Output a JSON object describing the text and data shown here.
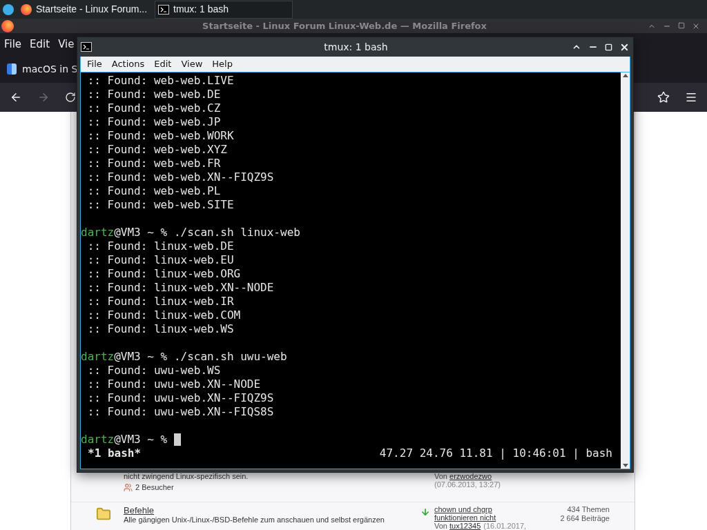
{
  "taskbar": {
    "tasks": [
      {
        "label": "Startseite - Linux Forum...",
        "kind": "browser",
        "selected": false
      },
      {
        "label": "tmux: 1 bash",
        "kind": "terminal",
        "selected": true
      }
    ]
  },
  "browser": {
    "title": "Startseite - Linux Forum Linux-Web.de — Mozilla Firefox",
    "menu": [
      "File",
      "Edit",
      "Vie"
    ],
    "tab": {
      "label": "macOS in S"
    },
    "forward_disabled": true,
    "forum_rows": [
      {
        "title": null,
        "description": "nicht zwingend Linux-spezifisch sein.",
        "visitors": "2 Besucher",
        "last_post": null,
        "author_prefix": "Von ",
        "author": "erzwodezwo",
        "date": "(07.06.2013, 13:27)",
        "stats": []
      },
      {
        "title": "Befehle",
        "description": "Alle gängigen Unix-/Linux-/BSD-Befehle zum anschauen und selbst ergänzen",
        "visitors": null,
        "last_post": [
          "chown und chgrp",
          "funktionieren nicht"
        ],
        "author_prefix": "Von ",
        "author": "tux12345",
        "date": "(16.01.2017,",
        "date_inline": true,
        "stats": [
          "434 Themen",
          "2 664 Beiträge"
        ]
      }
    ]
  },
  "terminal": {
    "title": "tmux: 1 bash",
    "menu": [
      "File",
      "Actions",
      "Edit",
      "View",
      "Help"
    ],
    "lines": [
      {
        "kind": "output",
        "text": " :: Found: web-web.LIVE"
      },
      {
        "kind": "output",
        "text": " :: Found: web-web.DE"
      },
      {
        "kind": "output",
        "text": " :: Found: web-web.CZ"
      },
      {
        "kind": "output",
        "text": " :: Found: web-web.JP"
      },
      {
        "kind": "output",
        "text": " :: Found: web-web.WORK"
      },
      {
        "kind": "output",
        "text": " :: Found: web-web.XYZ"
      },
      {
        "kind": "output",
        "text": " :: Found: web-web.FR"
      },
      {
        "kind": "output",
        "text": " :: Found: web-web.XN--FIQZ9S"
      },
      {
        "kind": "output",
        "text": " :: Found: web-web.PL"
      },
      {
        "kind": "output",
        "text": " :: Found: web-web.SITE"
      },
      {
        "kind": "blank"
      },
      {
        "kind": "prompt",
        "user": "dartz",
        "host": "@VM3 ~ % ",
        "command": "./scan.sh linux-web",
        "cursor": false
      },
      {
        "kind": "output",
        "text": " :: Found: linux-web.DE"
      },
      {
        "kind": "output",
        "text": " :: Found: linux-web.EU"
      },
      {
        "kind": "output",
        "text": " :: Found: linux-web.ORG"
      },
      {
        "kind": "output",
        "text": " :: Found: linux-web.XN--NODE"
      },
      {
        "kind": "output",
        "text": " :: Found: linux-web.IR"
      },
      {
        "kind": "output",
        "text": " :: Found: linux-web.COM"
      },
      {
        "kind": "output",
        "text": " :: Found: linux-web.WS"
      },
      {
        "kind": "blank"
      },
      {
        "kind": "prompt",
        "user": "dartz",
        "host": "@VM3 ~ % ",
        "command": "./scan.sh uwu-web",
        "cursor": false
      },
      {
        "kind": "output",
        "text": " :: Found: uwu-web.WS"
      },
      {
        "kind": "output",
        "text": " :: Found: uwu-web.XN--NODE"
      },
      {
        "kind": "output",
        "text": " :: Found: uwu-web.XN--FIQZ9S"
      },
      {
        "kind": "output",
        "text": " :: Found: uwu-web.XN--FIQS8S"
      },
      {
        "kind": "blank"
      },
      {
        "kind": "prompt",
        "user": "dartz",
        "host": "@VM3 ~ % ",
        "cursor": true
      }
    ],
    "status": {
      "window": "*1 bash*",
      "right": "47.27 24.76 11.81 | 10:46:01 | bash"
    }
  }
}
